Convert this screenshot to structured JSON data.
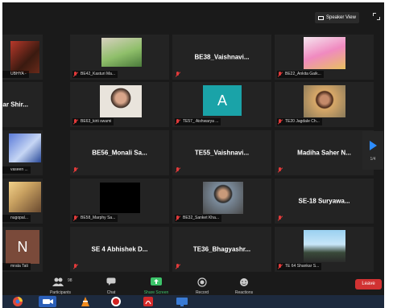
{
  "topbar": {
    "speaker_view": "Speaker View"
  },
  "tiles": [
    {
      "id": "r1c1",
      "label": "UBHYA -",
      "mode": "photo"
    },
    {
      "id": "r1c2",
      "label": "BE42_Kasturi Ma...",
      "mode": "photo"
    },
    {
      "id": "r1c3",
      "name": "BE38_Vaishnavi...",
      "mode": "name"
    },
    {
      "id": "r1c4",
      "label": "BE22_Ankita Gaik...",
      "mode": "photo"
    },
    {
      "id": "r2c1",
      "name": "umar Shir...",
      "mode": "name"
    },
    {
      "id": "r2c2",
      "label": "BE63_kirti swami",
      "mode": "photo"
    },
    {
      "id": "r2c3",
      "label": "TE57_ Aishwarya ...",
      "mode": "letter",
      "letter": "A"
    },
    {
      "id": "r2c4",
      "label": "TE20 Jagdale Ch...",
      "mode": "photo"
    },
    {
      "id": "r3c1",
      "label": "vaseen ...",
      "mode": "photo"
    },
    {
      "id": "r3c2",
      "name": "BE56_Monali Sa...",
      "mode": "name"
    },
    {
      "id": "r3c3",
      "name": "TE55_Vaishnavi...",
      "mode": "name"
    },
    {
      "id": "r3c4",
      "name": "Madiha Saher N...",
      "mode": "name"
    },
    {
      "id": "r4c1",
      "label": "nugopal...",
      "mode": "photo"
    },
    {
      "id": "r4c2",
      "label": "BE58_Marphy Sa...",
      "mode": "photo"
    },
    {
      "id": "r4c3",
      "label": "BE32_Sanket Kha...",
      "mode": "photo"
    },
    {
      "id": "r4c4",
      "name": "SE-18  Suryawa...",
      "mode": "name"
    },
    {
      "id": "r5c1",
      "label": "mrata Tati",
      "mode": "letter",
      "letter": "N"
    },
    {
      "id": "r5c2",
      "name": "SE 4  Abhishek D...",
      "mode": "name"
    },
    {
      "id": "r5c3",
      "name": "TE36_Bhagyashr...",
      "mode": "name"
    },
    {
      "id": "r5c4",
      "label": "TE 64 Shankar S...",
      "mode": "photo"
    }
  ],
  "pager": {
    "page": "1/4"
  },
  "toolbar": {
    "participants": "Participants",
    "participants_count": "98",
    "chat": "Chat",
    "share_screen": "Share Screen",
    "record": "Record",
    "reactions": "Reactions",
    "leave": "Leave"
  },
  "colors": {
    "accent": "#2d8cff",
    "share": "#3cc46a",
    "leave": "#d13232",
    "mic_muted": "#e23a3a",
    "avatar_teal": "#1aa3a8",
    "avatar_brown": "#7a4a3a"
  }
}
